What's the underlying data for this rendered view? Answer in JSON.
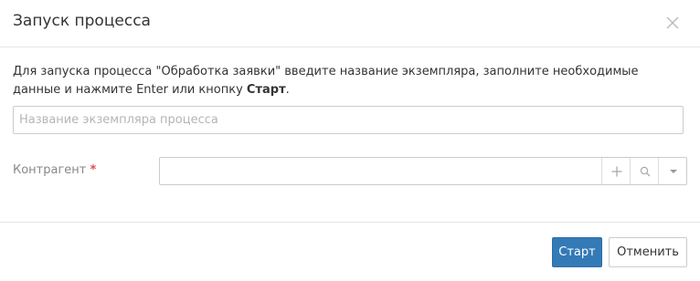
{
  "dialog": {
    "title": "Запуск процесса",
    "close_icon": "close-icon",
    "description": {
      "text_before": "Для запуска процесса \"Обработка заявки\" введите название экземпляра, заполните необходимые данные и нажмите Enter или кнопку ",
      "button_ref": "Старт",
      "text_after": "."
    },
    "instance_name": {
      "value": "",
      "placeholder": "Название экземпляра процесса"
    },
    "contractor": {
      "label": "Контрагент",
      "required_mark": "*",
      "value": "",
      "icons": [
        "plus-icon",
        "search-icon",
        "caret-down-icon"
      ]
    },
    "buttons": {
      "start_label": "Старт",
      "cancel_label": "Отменить"
    },
    "colors": {
      "primary": "#337ab7",
      "required": "#d9534f",
      "border": "#cccccc"
    }
  }
}
